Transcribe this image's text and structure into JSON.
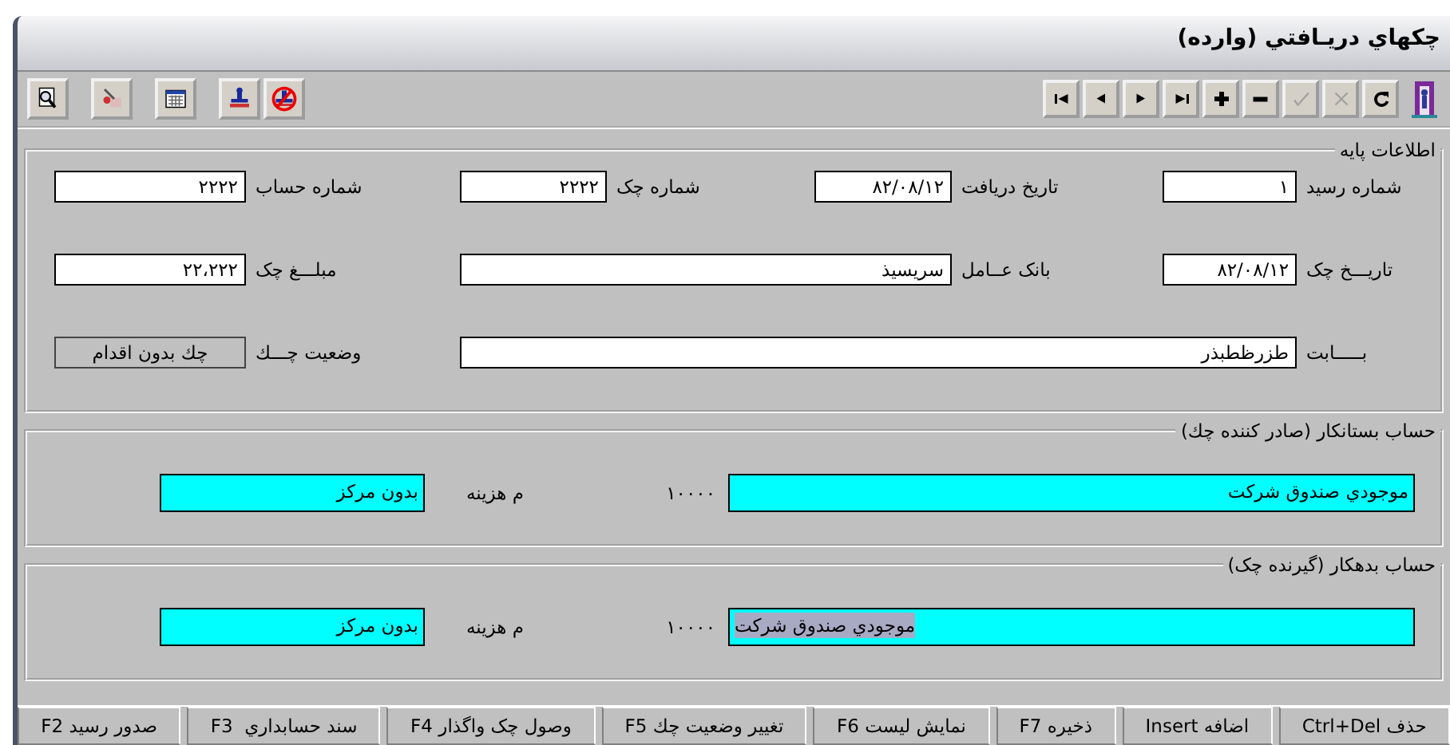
{
  "window": {
    "title": "چکهاي دريـافتي (وارده)"
  },
  "toolbar": {
    "tools": [
      {
        "kind": "preview"
      },
      {
        "kind": "tools"
      },
      {
        "kind": "calendar"
      },
      {
        "kind": "stamp"
      },
      {
        "kind": "unstamp"
      }
    ],
    "nav_buttons": [
      {
        "kind": "first",
        "disabled": false
      },
      {
        "kind": "prior",
        "disabled": false
      },
      {
        "kind": "next",
        "disabled": false
      },
      {
        "kind": "last",
        "disabled": false
      },
      {
        "kind": "insert",
        "disabled": false
      },
      {
        "kind": "delete",
        "disabled": false
      },
      {
        "kind": "post",
        "disabled": true
      },
      {
        "kind": "cancel",
        "disabled": true
      },
      {
        "kind": "refresh",
        "disabled": false
      }
    ]
  },
  "basic_info": {
    "title": "اطلاعات پایه",
    "fields": [
      {
        "label": "شماره رسید",
        "value": "۱",
        "kind": "field"
      },
      {
        "label": "تاریخ دریافت",
        "value": "۸۲/۰۸/۱۲",
        "kind": "field"
      },
      {
        "label": "شماره چک",
        "value": "۲۲۲۲",
        "kind": "field"
      },
      {
        "label": "شماره حساب",
        "value": "۲۲۲۲",
        "kind": "field"
      },
      {
        "label": "تاریـــخ چک",
        "value": "۸۲/۰۸/۱۲",
        "kind": "field"
      },
      {
        "label": "بانک عــامل",
        "value": "سریسیذ",
        "kind": "wide"
      },
      {
        "label": "مبلـــغ چک",
        "value": "۲۲،۲۲۲",
        "kind": "field"
      },
      {
        "label": "بـــــابت",
        "value": "طزرظطبذر",
        "kind": "full"
      },
      {
        "label": "وضعیت چـــك",
        "value": "چك بدون اقدام",
        "kind": "status"
      }
    ]
  },
  "accounts": [
    {
      "title": "حساب بستانکار (صادر کننده چك)",
      "account_name": "موجودي صندوق شرکت",
      "name_selected": false,
      "account_code": "۱۰۰۰۰",
      "cost_center_label": "م هزینه",
      "cost_center": "بدون مرکز"
    },
    {
      "title": "حساب بدهکار (گیرنده چک)",
      "account_name": "موجودي صندوق شرکت",
      "name_selected": true,
      "account_code": "۱۰۰۰۰",
      "cost_center_label": "م هزینه",
      "cost_center": "بدون مرکز"
    }
  ],
  "function_keys": [
    "حذف Ctrl+Del",
    "اضافه Insert",
    "ذخیره F7",
    "نمایش لیست F6",
    "تغییر وضعیت چك F5",
    "وصول چک واگذار F4",
    "سند حسابداري  F3",
    "صدور رسید F2"
  ]
}
